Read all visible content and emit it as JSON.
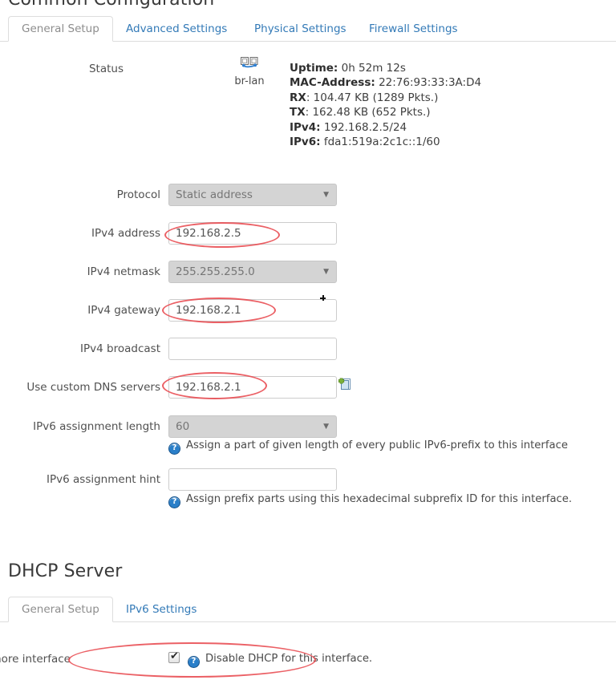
{
  "sections": {
    "common": {
      "title": "Common Configuration",
      "tabs": [
        {
          "label": "General Setup",
          "active": true
        },
        {
          "label": "Advanced Settings",
          "active": false
        },
        {
          "label": "Physical Settings",
          "active": false
        },
        {
          "label": "Firewall Settings",
          "active": false
        }
      ]
    },
    "dhcp": {
      "title": "DHCP Server",
      "tabs": [
        {
          "label": "General Setup",
          "active": true
        },
        {
          "label": "IPv6 Settings",
          "active": false
        }
      ]
    }
  },
  "status": {
    "label": "Status",
    "icon": "network-bridge-icon",
    "interface_name": "br-lan",
    "lines": [
      {
        "key": "Uptime:",
        "value": "0h 52m 12s"
      },
      {
        "key": "MAC-Address:",
        "value": "22:76:93:33:3A:D4"
      },
      {
        "key": "RX",
        "value": ": 104.47 KB (1289 Pkts.)"
      },
      {
        "key": "TX",
        "value": ": 162.48 KB (652 Pkts.)"
      },
      {
        "key": "IPv4:",
        "value": "192.168.2.5/24"
      },
      {
        "key": "IPv6:",
        "value": "fda1:519a:2c1c::1/60"
      }
    ]
  },
  "form": {
    "protocol": {
      "label": "Protocol",
      "value": "Static address",
      "type": "select",
      "disabled": true
    },
    "ipv4_address": {
      "label": "IPv4 address",
      "value": "192.168.2.5",
      "type": "text",
      "placeholder": ""
    },
    "ipv4_netmask": {
      "label": "IPv4 netmask",
      "value": "255.255.255.0",
      "type": "select",
      "disabled": true
    },
    "ipv4_gateway": {
      "label": "IPv4 gateway",
      "value": "192.168.2.1",
      "type": "text",
      "placeholder": ""
    },
    "ipv4_broadcast": {
      "label": "IPv4 broadcast",
      "value": "",
      "type": "text",
      "placeholder": ""
    },
    "dns_servers": {
      "label": "Use custom DNS servers",
      "value": "192.168.2.1",
      "type": "text",
      "placeholder": "",
      "add_icon": "add-document-icon"
    },
    "ipv6_assignment_length": {
      "label": "IPv6 assignment length",
      "value": "60",
      "type": "select",
      "disabled": true,
      "hint_icon": "help-icon",
      "hint": "Assign a part of given length of every public IPv6-prefix to this interface"
    },
    "ipv6_assignment_hint": {
      "label": "IPv6 assignment hint",
      "value": "",
      "type": "text",
      "placeholder": "",
      "hint_icon": "help-icon",
      "hint": "Assign prefix parts using this hexadecimal subprefix ID for this interface."
    },
    "ignore_interface": {
      "label": "Ignore interface",
      "checked": true,
      "hint_icon": "help-icon",
      "hint": "Disable DHCP for this interface.",
      "check_glyph": "✔"
    }
  },
  "glyphs": {
    "caret_down": "▼",
    "help": "?"
  },
  "colors": {
    "link": "#337ab7",
    "annotation": "#e8444a",
    "disabled_field": "#d4d4d4",
    "border": "#cccccc"
  },
  "annotations": [
    {
      "name": "annotation-ipv4-address"
    },
    {
      "name": "annotation-ipv4-gateway"
    },
    {
      "name": "annotation-dns-servers"
    },
    {
      "name": "annotation-ignore-interface"
    }
  ]
}
